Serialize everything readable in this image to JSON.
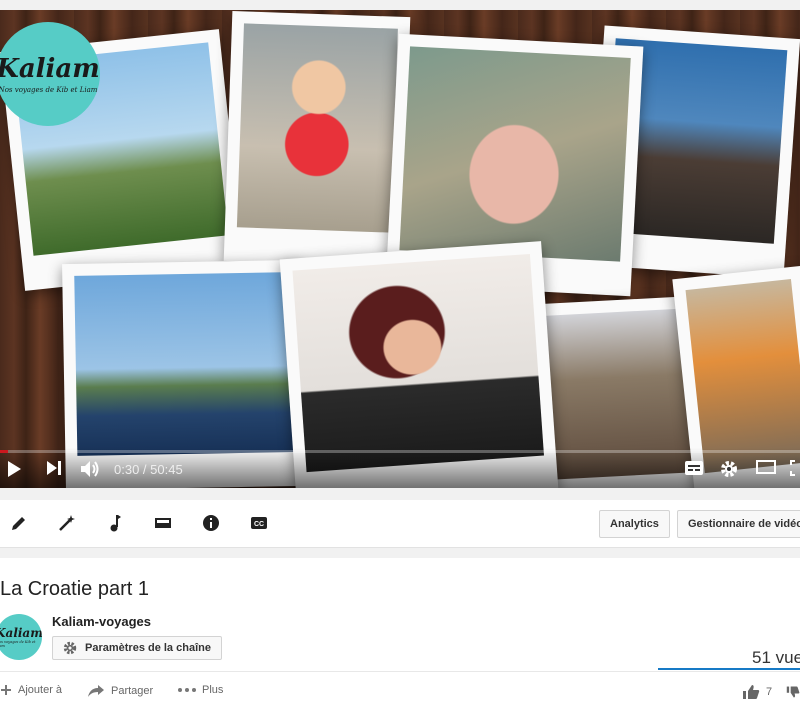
{
  "brand": {
    "name": "Kaliam",
    "tagline": "Nos voyages de Kib et Liam"
  },
  "player": {
    "time_current": "0:30",
    "time_sep": " / ",
    "time_total": "50:45",
    "progress_fraction": 0.0099,
    "icons": [
      "play-icon",
      "next-icon",
      "volume-icon",
      "subtitles-icon",
      "gear-icon",
      "theater-mode-icon",
      "fullscreen-icon"
    ]
  },
  "toolbar": {
    "icons": [
      "pencil-icon",
      "magic-wand-icon",
      "music-note-icon",
      "card-icon",
      "info-icon",
      "cc-icon"
    ],
    "analytics_label": "Analytics",
    "manager_label": "Gestionnaire de vidéos"
  },
  "video": {
    "title": "La Croatie part 1",
    "channel": "Kaliam-voyages",
    "settings_label": "Paramètres de la chaîne",
    "views": "51 vue",
    "likes": "7"
  },
  "actions": {
    "add_label": "Ajouter à",
    "share_label": "Partager",
    "more_label": "Plus"
  },
  "colors": {
    "accent": "#cc181e",
    "brand_teal": "#56ccc6",
    "sentiment_bar": "#167ac6"
  }
}
